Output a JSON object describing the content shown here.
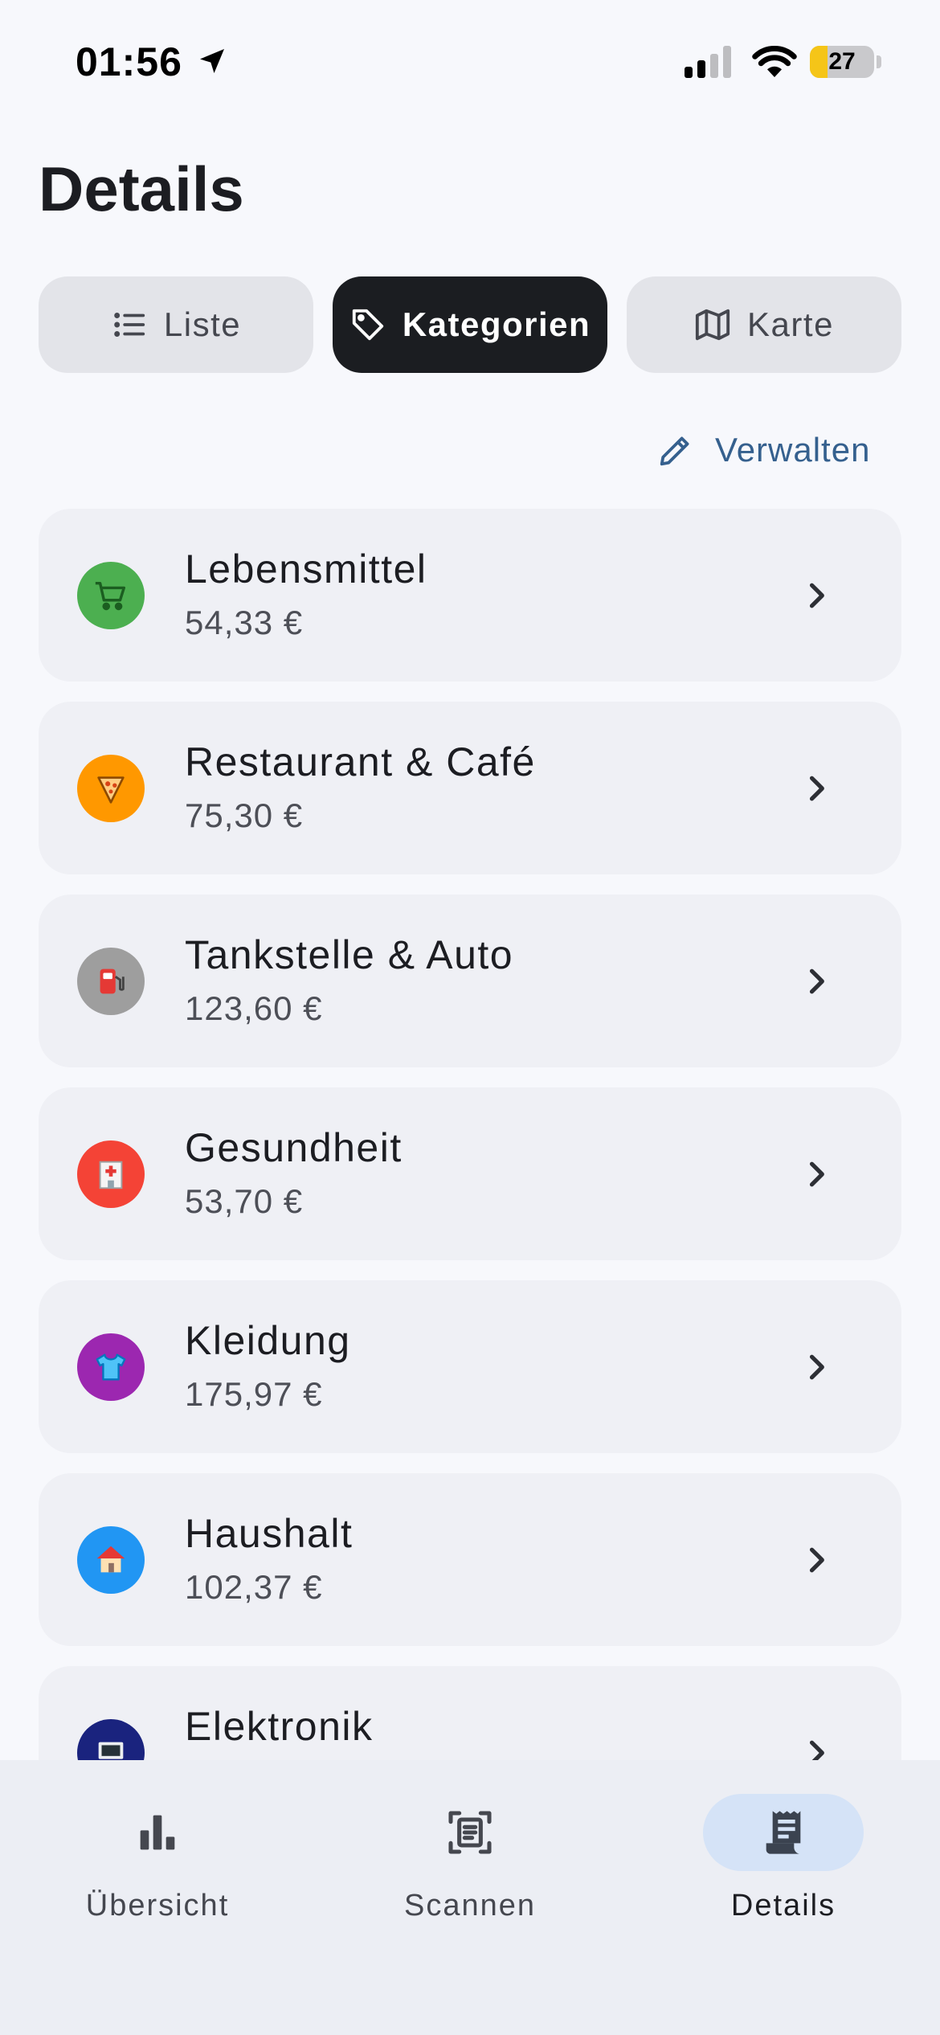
{
  "status_bar": {
    "time": "01:56",
    "battery_level": "27",
    "battery_fraction": 0.27,
    "icons": [
      "location-arrow-icon",
      "cellular-signal-icon",
      "wifi-icon",
      "battery-icon"
    ]
  },
  "page": {
    "title": "Details"
  },
  "segments": [
    {
      "label": "Liste",
      "icon": "list-icon",
      "selected": false
    },
    {
      "label": "Kategorien",
      "icon": "tag-icon",
      "selected": true
    },
    {
      "label": "Karte",
      "icon": "map-icon",
      "selected": false
    }
  ],
  "manage": {
    "label": "Verwalten",
    "icon": "pencil-icon"
  },
  "categories": [
    {
      "name": "Lebensmittel",
      "amount": "54,33 €",
      "icon": "shopping-cart-icon",
      "color": "#4caf50"
    },
    {
      "name": "Restaurant & Café",
      "amount": "75,30 €",
      "icon": "pizza-icon",
      "color": "#ff9800"
    },
    {
      "name": "Tankstelle & Auto",
      "amount": "123,60 €",
      "icon": "fuel-pump-icon",
      "color": "#9e9e9e"
    },
    {
      "name": "Gesundheit",
      "amount": "53,70 €",
      "icon": "hospital-icon",
      "color": "#f44336"
    },
    {
      "name": "Kleidung",
      "amount": "175,97 €",
      "icon": "shirt-icon",
      "color": "#9c27b0"
    },
    {
      "name": "Haushalt",
      "amount": "102,37 €",
      "icon": "house-icon",
      "color": "#2196f3"
    },
    {
      "name": "Elektronik",
      "amount": "",
      "icon": "computer-icon",
      "color": "#1a237e"
    }
  ],
  "bottom_nav": [
    {
      "label": "Übersicht",
      "icon": "bar-chart-icon",
      "selected": false
    },
    {
      "label": "Scannen",
      "icon": "document-scan-icon",
      "selected": false
    },
    {
      "label": "Details",
      "icon": "receipt-icon",
      "selected": true
    }
  ],
  "colors": {
    "background": "#f7f8fc",
    "card": "#eff0f5",
    "selected_segment": "#1b1d21",
    "accent": "#35608e",
    "nav_selected": "#d5e3f7"
  }
}
